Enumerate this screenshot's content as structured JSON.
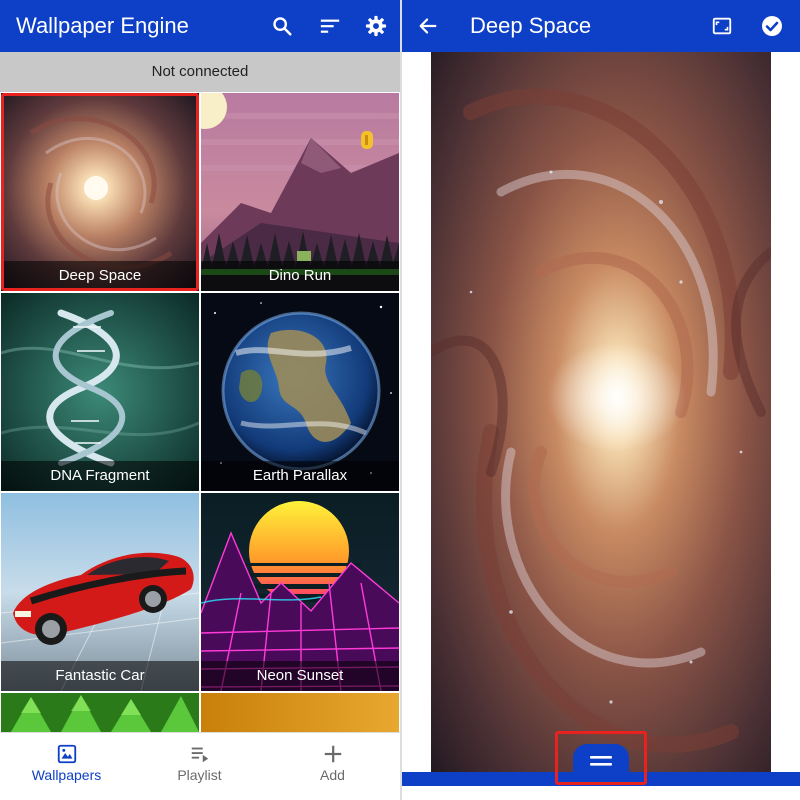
{
  "left": {
    "title": "Wallpaper Engine",
    "icons": {
      "search": "search-icon",
      "sort": "sort-icon",
      "settings": "gear-icon"
    },
    "status": "Not connected",
    "wallpapers": [
      {
        "label": "Deep Space",
        "selected": true
      },
      {
        "label": "Dino Run",
        "selected": false
      },
      {
        "label": "DNA Fragment",
        "selected": false
      },
      {
        "label": "Earth Parallax",
        "selected": false
      },
      {
        "label": "Fantastic Car",
        "selected": false
      },
      {
        "label": "Neon Sunset",
        "selected": false
      }
    ],
    "nav": [
      {
        "label": "Wallpapers",
        "icon": "wallpapers-icon",
        "active": true
      },
      {
        "label": "Playlist",
        "icon": "playlist-icon",
        "active": false
      },
      {
        "label": "Add",
        "icon": "plus-icon",
        "active": false
      }
    ]
  },
  "right": {
    "title": "Deep Space",
    "icons": {
      "back": "arrow-left-icon",
      "crop": "crop-icon",
      "apply": "check-circle-icon",
      "handle": "drawer-handle-icon"
    }
  },
  "colors": {
    "primary": "#0d3fc7",
    "highlight": "#e8231f",
    "status_bg": "#c8c8c8"
  }
}
